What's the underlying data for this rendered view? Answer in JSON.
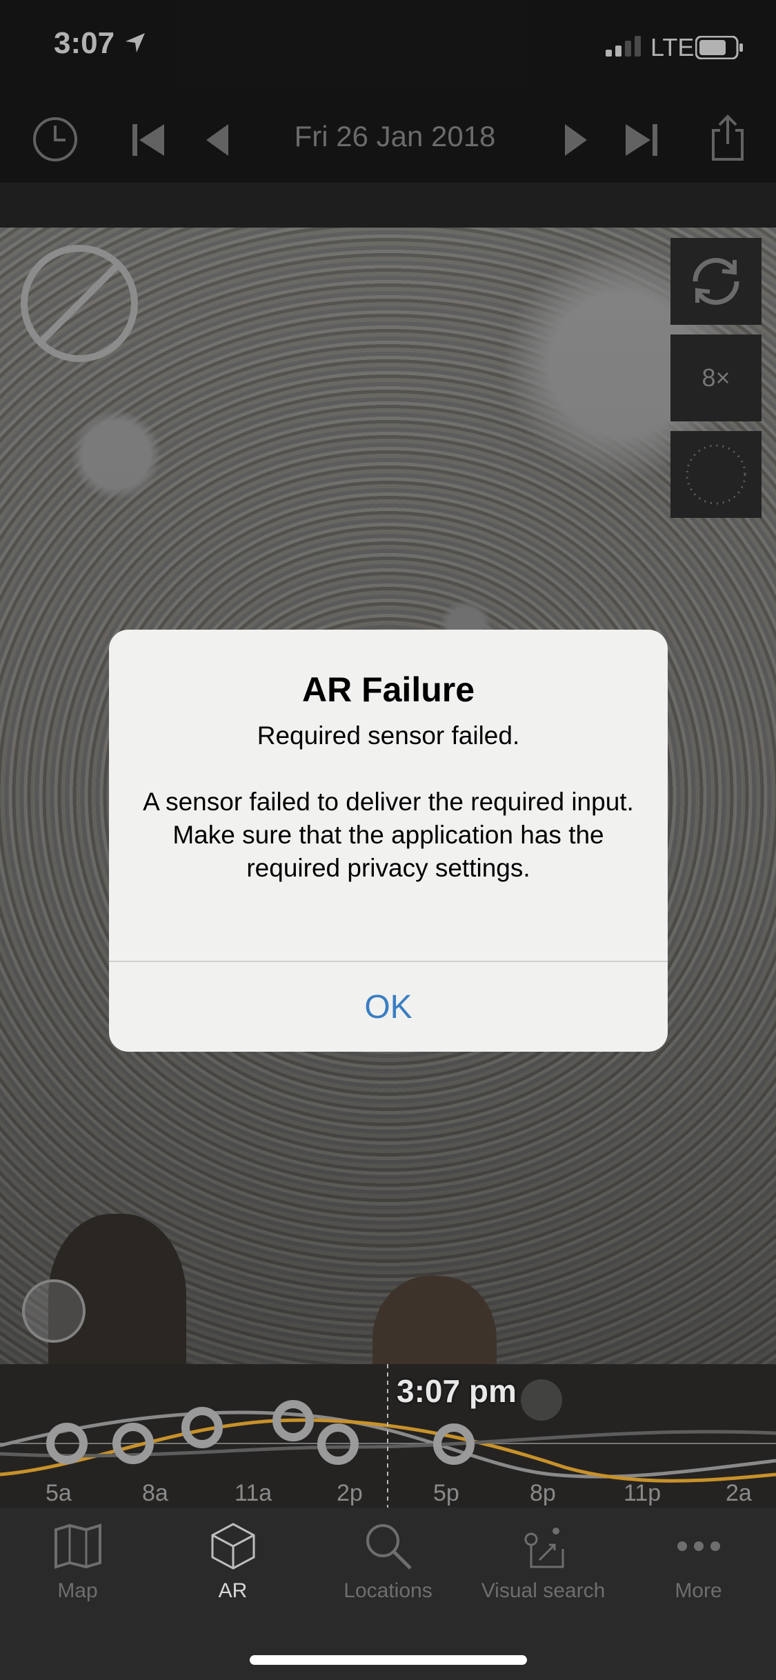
{
  "status_bar": {
    "time": "3:07",
    "network": "LTE"
  },
  "toolbar": {
    "date": "Fri 26 Jan 2018"
  },
  "camera": {
    "zoom_label": "8×"
  },
  "alert": {
    "title": "AR Failure",
    "message": "Required sensor failed.\n\nA sensor failed to deliver the required input.\nMake sure that the application has the required privacy settings.",
    "ok_label": "OK"
  },
  "timeline": {
    "current_time": "3:07 pm",
    "labels": [
      "5a",
      "8a",
      "11a",
      "2p",
      "5p",
      "8p",
      "11p",
      "2a"
    ]
  },
  "tabs": [
    {
      "label": "Map",
      "icon": "map-icon",
      "active": false
    },
    {
      "label": "AR",
      "icon": "cube-icon",
      "active": true
    },
    {
      "label": "Locations",
      "icon": "search-icon",
      "active": false
    },
    {
      "label": "Visual search",
      "icon": "visual-search-icon",
      "active": false
    },
    {
      "label": "More",
      "icon": "more-icon",
      "active": false
    }
  ],
  "colors": {
    "accent": "#3a7ec2",
    "sun_curve": "#c8922a",
    "moon_curve": "#8a8a8a"
  }
}
